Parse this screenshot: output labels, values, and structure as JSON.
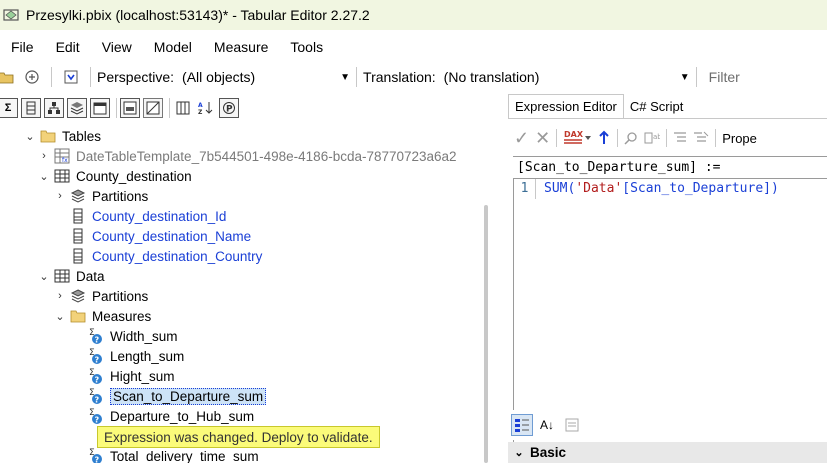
{
  "window": {
    "title": "Przesylki.pbix (localhost:53143)* - Tabular Editor 2.27.2"
  },
  "menu": {
    "items": [
      "File",
      "Edit",
      "View",
      "Model",
      "Measure",
      "Tools"
    ]
  },
  "toolbar": {
    "perspective_label": "Perspective:",
    "perspective_value": "(All objects)",
    "translation_label": "Translation:",
    "translation_value": "(No translation)",
    "filter_placeholder": "Filter"
  },
  "tree": {
    "tables_label": "Tables",
    "date_table": "DateTableTemplate_7b544501-498e-4186-bcda-78770723a6a2",
    "county_table": "County_destination",
    "county_partitions": "Partitions",
    "county_columns": [
      "County_destination_Id",
      "County_destination_Name",
      "County_destination_Country"
    ],
    "data_table": "Data",
    "data_partitions": "Partitions",
    "measures_folder": "Measures",
    "measures": [
      "Width_sum",
      "Length_sum",
      "Hight_sum",
      "Scan_to_Departure_sum",
      "Departure_to_Hub_sum",
      "Total_delivery_time_sum"
    ]
  },
  "tooltip": {
    "text": "Expression was changed. Deploy to validate."
  },
  "editor": {
    "tabs": [
      "Expression Editor",
      "C# Script"
    ],
    "properties_label": "Prope",
    "header": "[Scan_to_Departure_sum] :=",
    "line_number": "1",
    "code_func": "SUM(",
    "code_str": "'Data'",
    "code_rest": "[Scan_to_Departure])"
  },
  "properties": {
    "sort_label": "A↓",
    "category": "Basic"
  },
  "colors": {
    "titlebar_bg": "#f1f6e1",
    "tooltip_bg": "#fbfb7a",
    "link_blue": "#1a3fd6"
  }
}
